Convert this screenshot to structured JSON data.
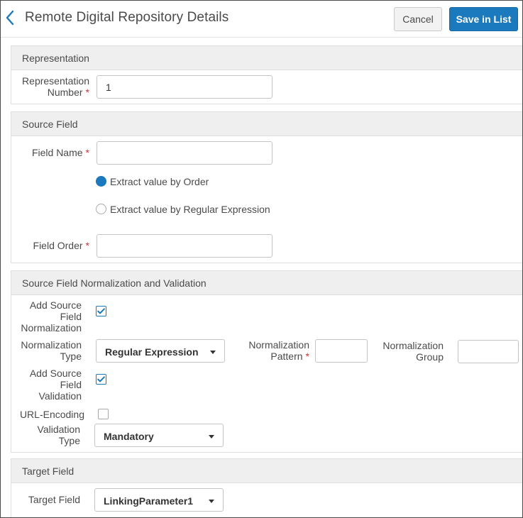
{
  "header": {
    "title": "Remote Digital Repository Details",
    "back_icon": "chevron-left-icon",
    "cancel_label": "Cancel",
    "save_label": "Save in List"
  },
  "representation": {
    "title": "Representation",
    "number_label_line1": "Representation",
    "number_label_line2": "Number",
    "number_value": "1"
  },
  "source_field": {
    "title": "Source Field",
    "field_name_label": "Field Name",
    "field_name_value": "",
    "extract_order_label": "Extract value by Order",
    "extract_order_selected": true,
    "extract_regex_label": "Extract value by Regular Expression",
    "extract_regex_selected": false,
    "field_order_label": "Field Order",
    "field_order_value": ""
  },
  "normalization": {
    "title": "Source Field Normalization and Validation",
    "add_normalization_label_line1": "Add Source",
    "add_normalization_label_line2": "Field",
    "add_normalization_label_line3": "Normalization",
    "add_normalization_checked": true,
    "normalization_type_label_line1": "Normalization",
    "normalization_type_label_line2": "Type",
    "normalization_type_value": "Regular Expression",
    "normalization_pattern_label_line1": "Normalization",
    "normalization_pattern_label_line2": "Pattern",
    "normalization_pattern_value": "",
    "normalization_group_label_line1": "Normalization",
    "normalization_group_label_line2": "Group",
    "normalization_group_value": "",
    "add_validation_label_line1": "Add Source",
    "add_validation_label_line2": "Field",
    "add_validation_label_line3": "Validation",
    "add_validation_checked": true,
    "url_encoding_label": "URL-Encoding",
    "url_encoding_checked": false,
    "validation_type_label_line1": "Validation",
    "validation_type_label_line2": "Type",
    "validation_type_value": "Mandatory"
  },
  "target_field": {
    "title": "Target Field",
    "target_field_label": "Target Field",
    "target_field_value": "LinkingParameter1"
  },
  "required_mark": "*",
  "colors": {
    "accent": "#1b79bd",
    "required": "#d32f2f",
    "section_header_bg": "#efefef"
  }
}
